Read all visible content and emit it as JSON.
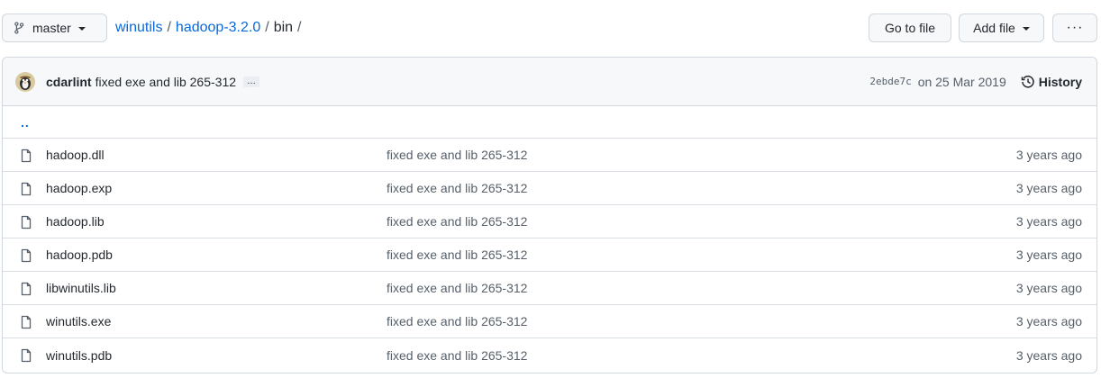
{
  "branch": {
    "label": "master"
  },
  "breadcrumb": {
    "repo": "winutils",
    "folder": "hadoop-3.2.0",
    "current": "bin",
    "separator": "/"
  },
  "actions": {
    "go_to_file": "Go to file",
    "add_file": "Add file",
    "more": "···"
  },
  "commit": {
    "author": "cdarlint",
    "message": "fixed exe and lib 265-312",
    "expand": "…",
    "sha": "2ebde7c",
    "date": "on 25 Mar 2019",
    "history": "History"
  },
  "parent_dir": "..",
  "files": [
    {
      "name": "hadoop.dll",
      "message": "fixed exe and lib 265-312",
      "age": "3 years ago"
    },
    {
      "name": "hadoop.exp",
      "message": "fixed exe and lib 265-312",
      "age": "3 years ago"
    },
    {
      "name": "hadoop.lib",
      "message": "fixed exe and lib 265-312",
      "age": "3 years ago"
    },
    {
      "name": "hadoop.pdb",
      "message": "fixed exe and lib 265-312",
      "age": "3 years ago"
    },
    {
      "name": "libwinutils.lib",
      "message": "fixed exe and lib 265-312",
      "age": "3 years ago"
    },
    {
      "name": "winutils.exe",
      "message": "fixed exe and lib 265-312",
      "age": "3 years ago"
    },
    {
      "name": "winutils.pdb",
      "message": "fixed exe and lib 265-312",
      "age": "3 years ago"
    }
  ],
  "colors": {
    "link": "#0969da",
    "muted": "#57606a",
    "border": "#d0d7de",
    "header_bg": "#f6f8fa"
  },
  "icons": {
    "branch": "git-branch-icon",
    "history": "history-icon",
    "file": "file-icon"
  }
}
